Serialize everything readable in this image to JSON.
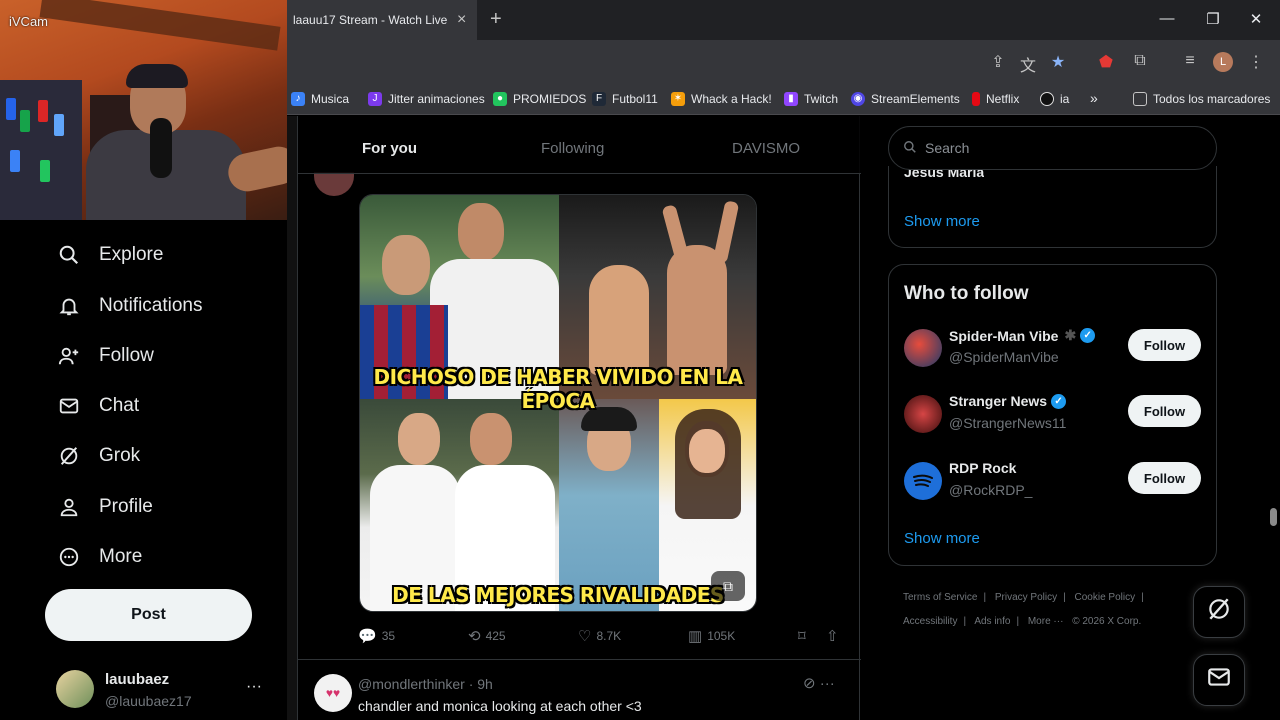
{
  "webcam": {
    "label": "iVCam"
  },
  "browser": {
    "tab_title": "laauu17 Stream - Watch Live or",
    "tab_close": "×",
    "new_tab": "+",
    "window_controls": {
      "minimize": "—",
      "maximize": "❐",
      "close": "✕"
    },
    "profile_initial": "L",
    "bookmarks": [
      {
        "label": "Musica",
        "icon_color": "#3b82f6"
      },
      {
        "label": "Jitter animaciones",
        "icon_color": "#7c3aed"
      },
      {
        "label": "PROMIEDOS",
        "icon_color": "#22c55e"
      },
      {
        "label": "Futbol11",
        "icon_color": "#1f2937"
      },
      {
        "label": "Whack a Hack!",
        "icon_color": "#f59e0b"
      },
      {
        "label": "Twitch",
        "icon_color": "#9146ff"
      },
      {
        "label": "StreamElements",
        "icon_color": "#4f46e5"
      },
      {
        "label": "Netflix",
        "icon_color": "#e50914"
      },
      {
        "label": "ia",
        "icon_color": "#111111"
      },
      {
        "label": "»",
        "icon_color": ""
      },
      {
        "label": "Todos los marcadores",
        "icon_color": ""
      }
    ]
  },
  "leftnav": {
    "items": [
      {
        "label": "Explore",
        "icon": "search-icon"
      },
      {
        "label": "Notifications",
        "icon": "bell-icon"
      },
      {
        "label": "Follow",
        "icon": "person-plus-icon"
      },
      {
        "label": "Chat",
        "icon": "mail-icon"
      },
      {
        "label": "Grok",
        "icon": "grok-icon"
      },
      {
        "label": "Profile",
        "icon": "person-icon"
      },
      {
        "label": "More",
        "icon": "more-circle-icon"
      }
    ],
    "post_label": "Post",
    "user": {
      "name": "lauubaez",
      "handle": "@lauubaez17",
      "menu": "···"
    }
  },
  "feed": {
    "tabs": [
      "For you",
      "Following",
      "DAVISMO"
    ],
    "post": {
      "caption_top": "DICHOSO DE HABER VIVIDO EN LA ÉPOCA",
      "caption_bottom": "DE LAS MEJORES RIVALIDADES",
      "replies": "35",
      "reposts": "425",
      "likes": "8.7K",
      "views": "105K"
    },
    "next_post": {
      "handle": "@mondlerthinker · 9h",
      "text": "chandler and monica looking at each other <3",
      "menu": "···"
    }
  },
  "sidebar": {
    "search_placeholder": "Search",
    "trend_cut": "Jesus Maria",
    "show_more": "Show more",
    "who_to_follow": {
      "title": "Who to follow",
      "accounts": [
        {
          "name": "Spider-Man Vibe",
          "handle": "@SpiderManVibe",
          "button": "Follow",
          "avatar_color": "#c0392b"
        },
        {
          "name": "Stranger News",
          "handle": "@StrangerNews11",
          "button": "Follow",
          "avatar_color": "#8e1c1c"
        },
        {
          "name": "RDP Rock",
          "handle": "@RockRDP_",
          "button": "Follow",
          "avatar_color": "#1e6fd9"
        }
      ],
      "show_more": "Show more"
    },
    "footer": [
      "Terms of Service",
      "|",
      "Privacy Policy",
      "|",
      "Cookie Policy",
      "|",
      "Accessibility",
      "|",
      "Ads info",
      "|",
      "More ···",
      "© 2026 X Corp."
    ]
  }
}
